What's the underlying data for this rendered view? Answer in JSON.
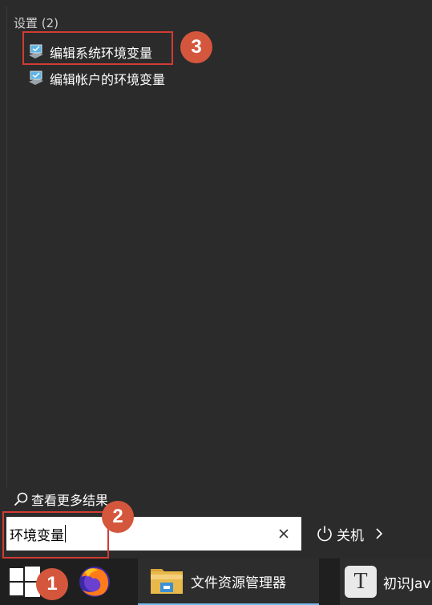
{
  "results": {
    "section_title": "设置 (2)",
    "items": [
      {
        "label": "编辑系统环境变量",
        "icon": "settings-monitor-icon"
      },
      {
        "label": "编辑帐户的环境变量",
        "icon": "settings-monitor-icon"
      }
    ]
  },
  "more_results": {
    "label": "查看更多结果",
    "icon": "search-icon"
  },
  "search": {
    "value": "环境变量",
    "clear_icon": "close-icon"
  },
  "power": {
    "label": "关机",
    "icon": "power-icon",
    "chevron": "chevron-right-icon"
  },
  "annotations": {
    "badge_1": "1",
    "badge_2": "2",
    "badge_3": "3",
    "badge_color": "#d4573d",
    "box_color": "#d23b34"
  },
  "taskbar": {
    "start_icon": "windows-logo-icon",
    "apps": [
      {
        "name": "firefox",
        "icon": "firefox-icon",
        "label": ""
      },
      {
        "name": "file-explorer",
        "icon": "folder-icon",
        "label": "文件资源管理器"
      },
      {
        "name": "typora",
        "icon": "typora-t-icon",
        "label": "初识Jav"
      }
    ]
  }
}
